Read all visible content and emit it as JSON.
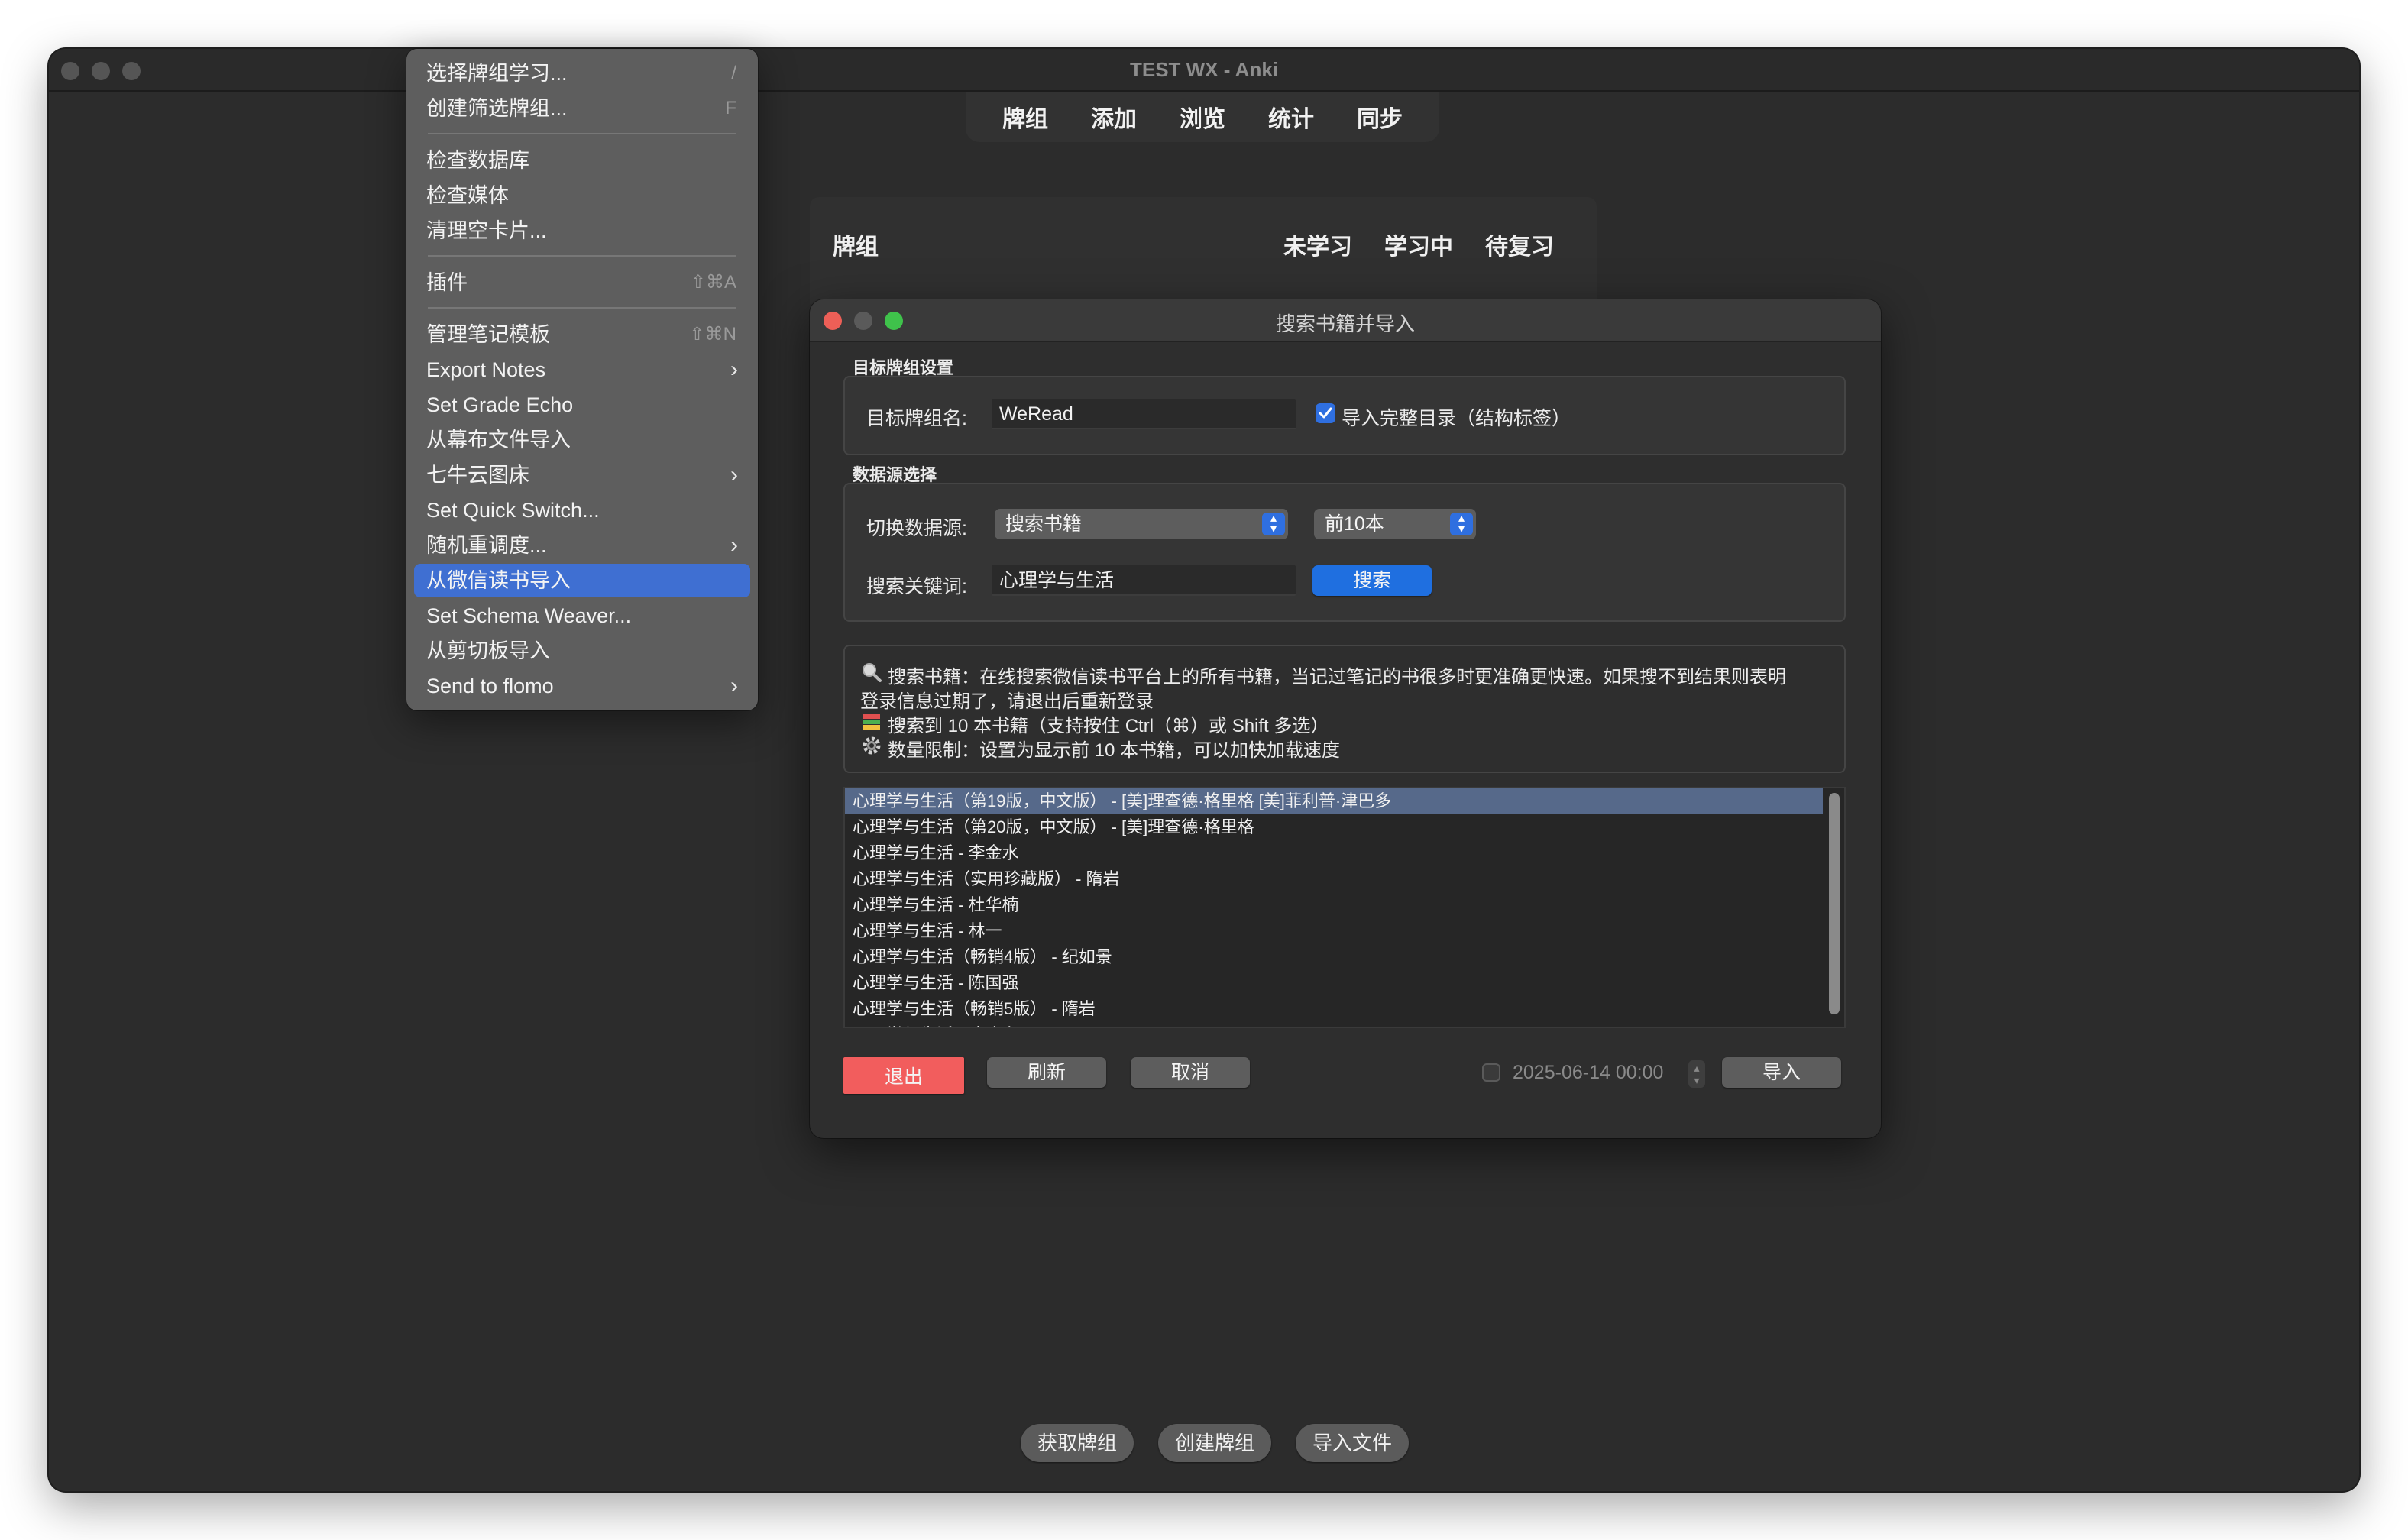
{
  "window": {
    "title": "TEST WX - Anki"
  },
  "toolbar": {
    "items": [
      "牌组",
      "添加",
      "浏览",
      "统计",
      "同步"
    ]
  },
  "deck_list": {
    "col_deck": "牌组",
    "col_new": "未学习",
    "col_learning": "学习中",
    "col_due": "待复习"
  },
  "bottom": {
    "get_shared": "获取牌组",
    "create_deck": "创建牌组",
    "import_file": "导入文件"
  },
  "menu": {
    "items": [
      {
        "label": "选择牌组学习...",
        "shortcut": "/"
      },
      {
        "label": "创建筛选牌组...",
        "shortcut": "F"
      },
      {
        "label": "检查数据库"
      },
      {
        "label": "检查媒体"
      },
      {
        "label": "清理空卡片..."
      },
      {
        "label": "插件",
        "shortcut": "⇧⌘A"
      },
      {
        "label": "管理笔记模板",
        "shortcut": "⇧⌘N"
      },
      {
        "label": "Export Notes",
        "submenu": "›"
      },
      {
        "label": "Set Grade Echo"
      },
      {
        "label": "从幕布文件导入"
      },
      {
        "label": "七牛云图床",
        "submenu": "›"
      },
      {
        "label": "Set Quick Switch..."
      },
      {
        "label": "随机重调度...",
        "submenu": "›"
      },
      {
        "label": "从微信读书导入",
        "selected": true
      },
      {
        "label": "Set Schema Weaver..."
      },
      {
        "label": "从剪切板导入"
      },
      {
        "label": "Send to flomo",
        "submenu": "›"
      }
    ]
  },
  "dialog": {
    "title": "搜索书籍并导入",
    "target_group": {
      "title": "目标牌组设置",
      "deck_name_label": "目标牌组名:",
      "deck_name_value": "WeRead",
      "import_toc_label": "导入完整目录（结构标签）",
      "import_toc_checked": true
    },
    "source_group": {
      "title": "数据源选择",
      "switch_label": "切换数据源:",
      "source_value": "搜索书籍",
      "limit_value": "前10本",
      "keyword_label": "搜索关键词:",
      "keyword_value": "心理学与生活",
      "search_button": "搜索"
    },
    "info": {
      "line1_icon": "magnifier-icon",
      "line1": "搜索书籍：在线搜索微信读书平台上的所有书籍，当记过笔记的书很多时更准确更快速。如果搜不到结果则表明",
      "line2": "登录信息过期了，请退出后重新登录",
      "line3_icon": "books-icon",
      "line3": "搜索到 10 本书籍（支持按住 Ctrl（⌘）或 Shift 多选）",
      "line4_icon": "gear-icon",
      "line4": "数量限制：设置为显示前 10 本书籍，可以加快加载速度"
    },
    "results": [
      "心理学与生活（第19版，中文版） - [美]理查德·格里格 [美]菲利普·津巴多",
      "心理学与生活（第20版，中文版） - [美]理查德·格里格",
      "心理学与生活 - 李金水",
      "心理学与生活（实用珍藏版） - 隋岩",
      "心理学与生活 - 杜华楠",
      "心理学与生活 - 林一",
      "心理学与生活（畅销4版） - 纪如景",
      "心理学与生活 - 陈国强",
      "心理学与生活（畅销5版） - 隋岩",
      "心理学与生活 - 陈晓东"
    ],
    "footer": {
      "logout": "退出",
      "refresh": "刷新",
      "cancel": "取消",
      "date_value": "2025-06-14 00:00",
      "import": "导入"
    },
    "colors": {
      "logout_bg": "#f25d5d",
      "search_bg": "#1f6fe0",
      "selected_row": "#56698a",
      "menu_selected": "#3f6fd2"
    }
  }
}
